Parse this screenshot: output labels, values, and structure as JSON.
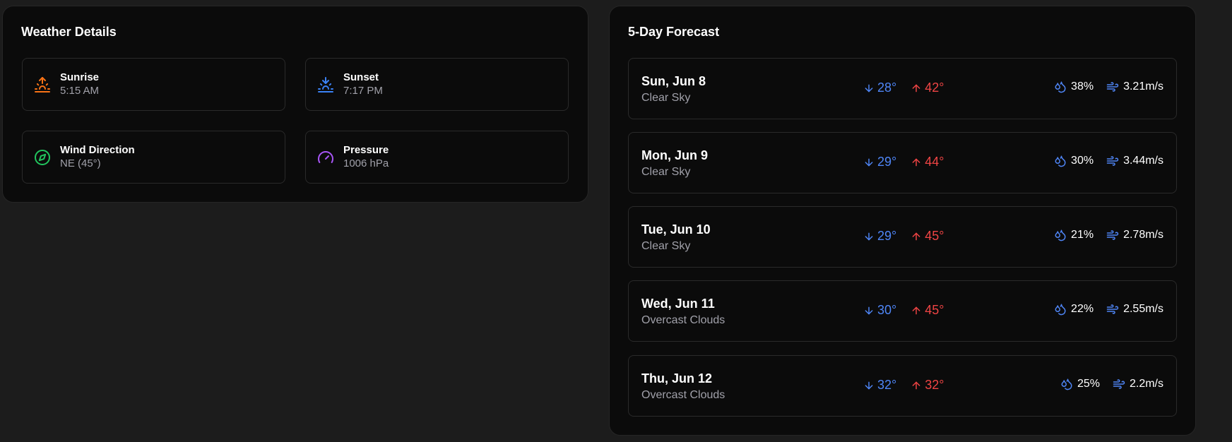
{
  "details": {
    "title": "Weather Details",
    "items": [
      {
        "label": "Sunrise",
        "value": "5:15 AM",
        "icon": "sunrise-icon",
        "color": "#f97316"
      },
      {
        "label": "Sunset",
        "value": "7:17 PM",
        "icon": "sunset-icon",
        "color": "#3b82f6"
      },
      {
        "label": "Wind Direction",
        "value": "NE (45°)",
        "icon": "compass-icon",
        "color": "#22c55e"
      },
      {
        "label": "Pressure",
        "value": "1006 hPa",
        "icon": "gauge-icon",
        "color": "#a855f7"
      }
    ]
  },
  "forecast": {
    "title": "5-Day Forecast",
    "days": [
      {
        "date": "Sun, Jun 8",
        "condition": "Clear Sky",
        "low": "28°",
        "high": "42°",
        "humidity": "38%",
        "wind": "3.21m/s"
      },
      {
        "date": "Mon, Jun 9",
        "condition": "Clear Sky",
        "low": "29°",
        "high": "44°",
        "humidity": "30%",
        "wind": "3.44m/s"
      },
      {
        "date": "Tue, Jun 10",
        "condition": "Clear Sky",
        "low": "29°",
        "high": "45°",
        "humidity": "21%",
        "wind": "2.78m/s"
      },
      {
        "date": "Wed, Jun 11",
        "condition": "Overcast Clouds",
        "low": "30°",
        "high": "45°",
        "humidity": "22%",
        "wind": "2.55m/s"
      },
      {
        "date": "Thu, Jun 12",
        "condition": "Overcast Clouds",
        "low": "32°",
        "high": "32°",
        "humidity": "25%",
        "wind": "2.2m/s"
      }
    ]
  },
  "colors": {
    "low_temp": "#4f86f7",
    "high_temp": "#ef4444",
    "muted_text": "#a1a1aa",
    "card_bg": "#0b0b0b",
    "page_bg": "#1c1c1c"
  }
}
